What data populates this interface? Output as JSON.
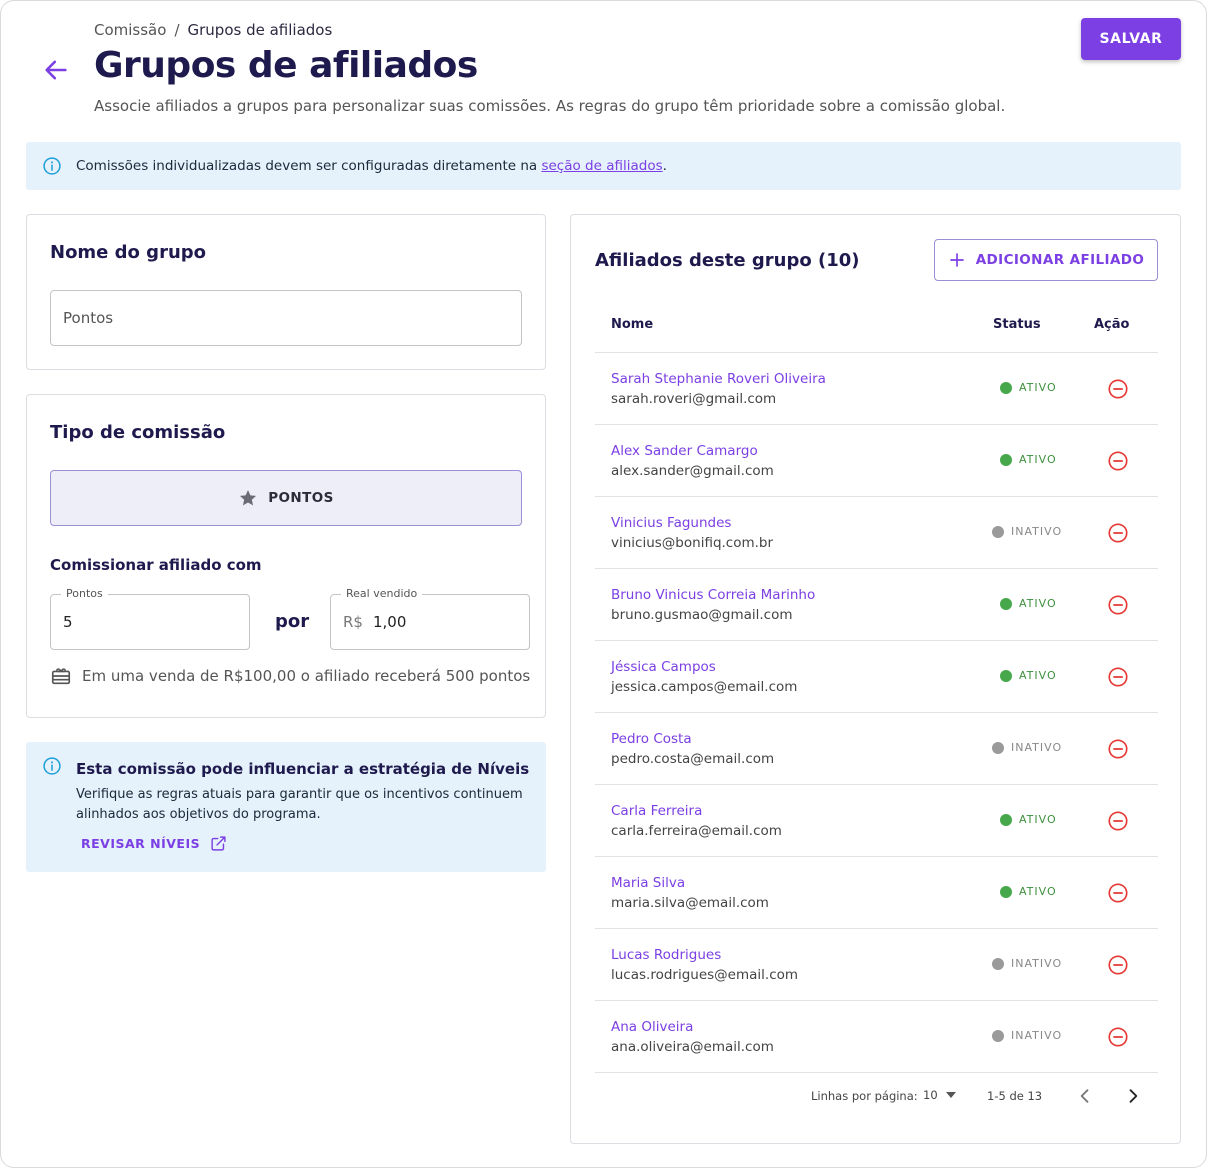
{
  "breadcrumb": {
    "parent": "Comissão",
    "separator": "/",
    "current": "Grupos de afiliados"
  },
  "header": {
    "title": "Grupos de afiliados",
    "subtitle": "Associe afiliados a grupos para personalizar suas comissões. As regras do grupo têm prioridade sobre a comissão global.",
    "save_label": "SALVAR"
  },
  "info_banner": {
    "text_before": "Comissões individualizadas devem ser configuradas diretamente na ",
    "link_text": "seção de afiliados",
    "text_after": "."
  },
  "group_name": {
    "title": "Nome do grupo",
    "value": "Pontos"
  },
  "commission_type": {
    "title": "Tipo de comissão",
    "option_label": "PONTOS",
    "commission_label": "Comissionar afiliado com",
    "points_legend": "Pontos",
    "points_value": "5",
    "por_label": "por",
    "real_legend": "Real vendido",
    "real_prefix": "R$",
    "real_value": "1,00",
    "helper_text": "Em uma venda de R$100,00 o afiliado receberá 500 pontos"
  },
  "levels_notice": {
    "title": "Esta comissão pode influenciar a estratégia de Níveis",
    "body": "Verifique as regras atuais para garantir que os incentivos continuem alinhados aos objetivos do programa.",
    "link_label": "REVISAR NÍVEIS"
  },
  "affiliates": {
    "title": "Afiliados deste grupo (10)",
    "add_label": "ADICIONAR AFILIADO",
    "columns": {
      "name": "Nome",
      "status": "Status",
      "action": "Ação"
    },
    "rows": [
      {
        "name": "Sarah Stephanie Roveri Oliveira",
        "email": "sarah.roveri@gmail.com",
        "status": "ATIVO"
      },
      {
        "name": "Alex Sander Camargo",
        "email": "alex.sander@gmail.com",
        "status": "ATIVO"
      },
      {
        "name": "Vinicius Fagundes",
        "email": "vinicius@bonifiq.com.br",
        "status": "INATIVO"
      },
      {
        "name": "Bruno Vinicus Correia Marinho",
        "email": "bruno.gusmao@gmail.com",
        "status": "ATIVO"
      },
      {
        "name": "Jéssica Campos",
        "email": "jessica.campos@email.com",
        "status": "ATIVO"
      },
      {
        "name": "Pedro Costa",
        "email": "pedro.costa@email.com",
        "status": "INATIVO"
      },
      {
        "name": "Carla Ferreira",
        "email": "carla.ferreira@email.com",
        "status": "ATIVO"
      },
      {
        "name": "Maria Silva",
        "email": "maria.silva@email.com",
        "status": "ATIVO"
      },
      {
        "name": "Lucas Rodrigues",
        "email": "lucas.rodrigues@email.com",
        "status": "INATIVO"
      },
      {
        "name": "Ana Oliveira",
        "email": "ana.oliveira@email.com",
        "status": "INATIVO"
      }
    ],
    "pagination": {
      "rows_per_page_label": "Linhas por página:",
      "rows_per_page": "10",
      "range": "1-5 de 13"
    }
  },
  "colors": {
    "accent": "#7b3fe4",
    "title": "#1f1a4d",
    "info_bg": "#e5f1fb",
    "active": "#46a84a",
    "inactive": "#9a9a9a",
    "remove": "#e53935"
  }
}
